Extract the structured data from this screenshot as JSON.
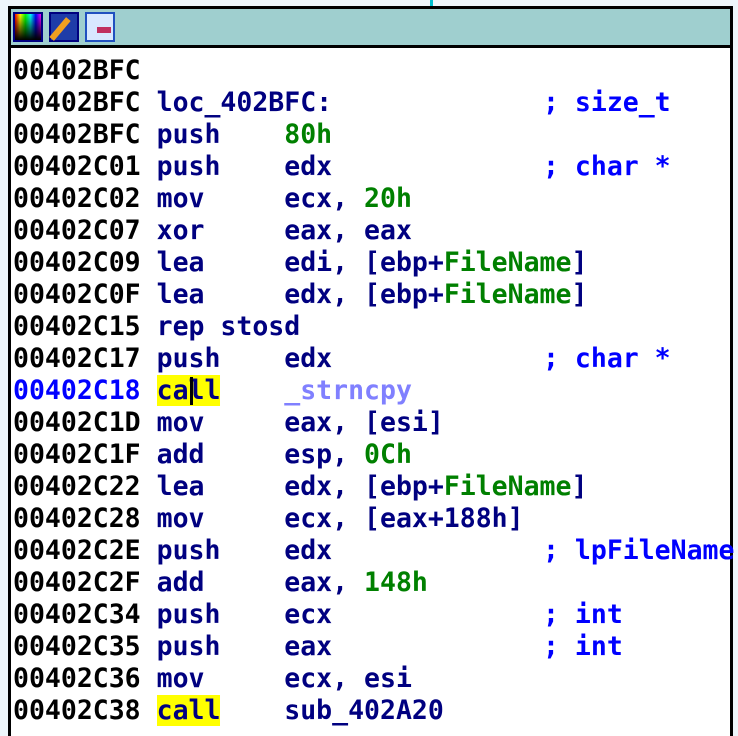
{
  "toolbar": {
    "icons": [
      "color-palette-icon",
      "edit-pencil-icon",
      "graph-flow-icon"
    ],
    "header_color": "#9fcfcf"
  },
  "current_address": "00402C18",
  "rows": [
    {
      "addr": "00402BFC",
      "mnem": "",
      "ops": [],
      "comment": ""
    },
    {
      "addr": "00402BFC",
      "mnem": "",
      "label": "loc_402BFC:",
      "ops": [],
      "comment": "; size_t"
    },
    {
      "addr": "00402BFC",
      "mnem": "push",
      "ops": [
        {
          "t": "80h",
          "k": "num"
        }
      ],
      "comment": ""
    },
    {
      "addr": "00402C01",
      "mnem": "push",
      "ops": [
        {
          "t": "edx",
          "k": "reg"
        }
      ],
      "comment": "; char *"
    },
    {
      "addr": "00402C02",
      "mnem": "mov",
      "ops": [
        {
          "t": "ecx, ",
          "k": "reg"
        },
        {
          "t": "20h",
          "k": "num"
        }
      ],
      "comment": ""
    },
    {
      "addr": "00402C07",
      "mnem": "xor",
      "ops": [
        {
          "t": "eax, eax",
          "k": "reg"
        }
      ],
      "comment": ""
    },
    {
      "addr": "00402C09",
      "mnem": "lea",
      "ops": [
        {
          "t": "edi, [ebp+",
          "k": "reg"
        },
        {
          "t": "FileName",
          "k": "var"
        },
        {
          "t": "]",
          "k": "reg"
        }
      ],
      "comment": ""
    },
    {
      "addr": "00402C0F",
      "mnem": "lea",
      "ops": [
        {
          "t": "edx, [ebp+",
          "k": "reg"
        },
        {
          "t": "FileName",
          "k": "var"
        },
        {
          "t": "]",
          "k": "reg"
        }
      ],
      "comment": ""
    },
    {
      "addr": "00402C15",
      "mnem": "rep stosd",
      "ops": [],
      "comment": ""
    },
    {
      "addr": "00402C17",
      "mnem": "push",
      "ops": [
        {
          "t": "edx",
          "k": "reg"
        }
      ],
      "comment": "; char *"
    },
    {
      "addr": "00402C18",
      "mnem": "call",
      "highlight": true,
      "ops": [
        {
          "t": "_strncpy",
          "k": "sym"
        }
      ],
      "comment": ""
    },
    {
      "addr": "00402C1D",
      "mnem": "mov",
      "ops": [
        {
          "t": "eax, [esi]",
          "k": "reg"
        }
      ],
      "comment": ""
    },
    {
      "addr": "00402C1F",
      "mnem": "add",
      "ops": [
        {
          "t": "esp, ",
          "k": "reg"
        },
        {
          "t": "0Ch",
          "k": "num"
        }
      ],
      "comment": ""
    },
    {
      "addr": "00402C22",
      "mnem": "lea",
      "ops": [
        {
          "t": "edx, [ebp+",
          "k": "reg"
        },
        {
          "t": "FileName",
          "k": "var"
        },
        {
          "t": "]",
          "k": "reg"
        }
      ],
      "comment": ""
    },
    {
      "addr": "00402C28",
      "mnem": "mov",
      "ops": [
        {
          "t": "ecx, [eax+188h]",
          "k": "reg"
        }
      ],
      "comment": ""
    },
    {
      "addr": "00402C2E",
      "mnem": "push",
      "ops": [
        {
          "t": "edx",
          "k": "reg"
        }
      ],
      "comment": "; lpFileName"
    },
    {
      "addr": "00402C2F",
      "mnem": "add",
      "ops": [
        {
          "t": "eax, ",
          "k": "reg"
        },
        {
          "t": "148h",
          "k": "num"
        }
      ],
      "comment": ""
    },
    {
      "addr": "00402C34",
      "mnem": "push",
      "ops": [
        {
          "t": "ecx",
          "k": "reg"
        }
      ],
      "comment": "; int"
    },
    {
      "addr": "00402C35",
      "mnem": "push",
      "ops": [
        {
          "t": "eax",
          "k": "reg"
        }
      ],
      "comment": "; int"
    },
    {
      "addr": "00402C36",
      "mnem": "mov",
      "ops": [
        {
          "t": "ecx, esi",
          "k": "reg"
        }
      ],
      "comment": ""
    },
    {
      "addr": "00402C38",
      "mnem": "call",
      "highlight": true,
      "ops": [
        {
          "t": "sub_402A20",
          "k": "name"
        }
      ],
      "comment": ""
    }
  ]
}
